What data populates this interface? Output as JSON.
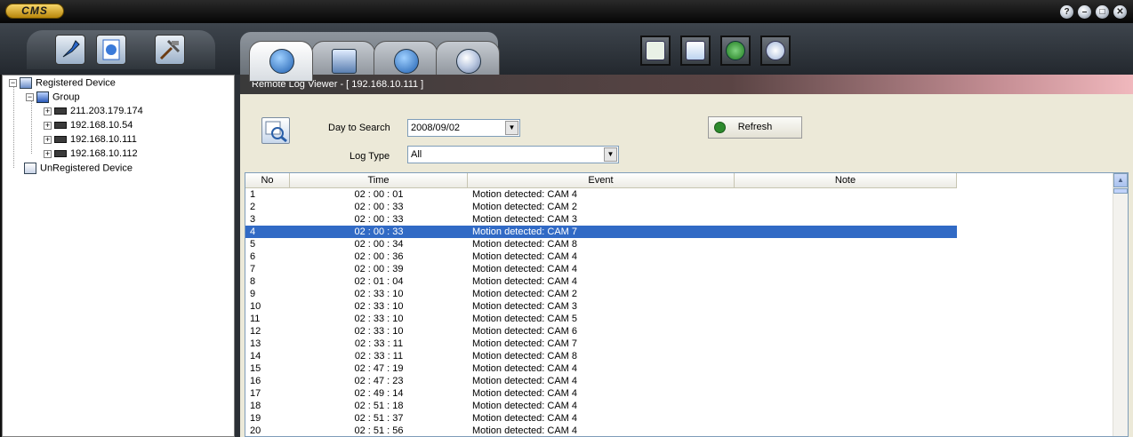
{
  "app": {
    "logo_text": "CMS"
  },
  "window_controls": [
    {
      "name": "help-button",
      "glyph": "?"
    },
    {
      "name": "minimize-button",
      "glyph": "–"
    },
    {
      "name": "maximize-button",
      "glyph": "□"
    },
    {
      "name": "close-button",
      "glyph": "✕"
    }
  ],
  "tree": {
    "registered": "Registered Device",
    "group": "Group",
    "devices": [
      "211.203.179.174",
      "192.168.10.54",
      "192.168.10.111",
      "192.168.10.112"
    ],
    "unregistered": "UnRegistered Device",
    "expand_glyph": "+",
    "collapse_glyph": "−"
  },
  "viewer": {
    "title": "Remote Log Viewer - [ 192.168.10.111 ]",
    "day_label": "Day to Search",
    "day_value": "2008/09/02",
    "logtype_label": "Log Type",
    "logtype_value": "All",
    "refresh_label": "Refresh",
    "dropdown_glyph": "▼"
  },
  "table": {
    "columns": [
      "No",
      "Time",
      "Event",
      "Note"
    ],
    "selected_row": 4,
    "rows": [
      [
        "1",
        "02 : 00 : 01",
        "Motion detected: CAM 4",
        ""
      ],
      [
        "2",
        "02 : 00 : 33",
        "Motion detected: CAM 2",
        ""
      ],
      [
        "3",
        "02 : 00 : 33",
        "Motion detected: CAM 3",
        ""
      ],
      [
        "4",
        "02 : 00 : 33",
        "Motion detected: CAM 7",
        ""
      ],
      [
        "5",
        "02 : 00 : 34",
        "Motion detected: CAM 8",
        ""
      ],
      [
        "6",
        "02 : 00 : 36",
        "Motion detected: CAM 4",
        ""
      ],
      [
        "7",
        "02 : 00 : 39",
        "Motion detected: CAM 4",
        ""
      ],
      [
        "8",
        "02 : 01 : 04",
        "Motion detected: CAM 4",
        ""
      ],
      [
        "9",
        "02 : 33 : 10",
        "Motion detected: CAM 2",
        ""
      ],
      [
        "10",
        "02 : 33 : 10",
        "Motion detected: CAM 3",
        ""
      ],
      [
        "11",
        "02 : 33 : 10",
        "Motion detected: CAM 5",
        ""
      ],
      [
        "12",
        "02 : 33 : 10",
        "Motion detected: CAM 6",
        ""
      ],
      [
        "13",
        "02 : 33 : 11",
        "Motion detected: CAM 7",
        ""
      ],
      [
        "14",
        "02 : 33 : 11",
        "Motion detected: CAM 8",
        ""
      ],
      [
        "15",
        "02 : 47 : 19",
        "Motion detected: CAM 4",
        ""
      ],
      [
        "16",
        "02 : 47 : 23",
        "Motion detected: CAM 4",
        ""
      ],
      [
        "17",
        "02 : 49 : 14",
        "Motion detected: CAM 4",
        ""
      ],
      [
        "18",
        "02 : 51 : 18",
        "Motion detected: CAM 4",
        ""
      ],
      [
        "19",
        "02 : 51 : 37",
        "Motion detected: CAM 4",
        ""
      ],
      [
        "20",
        "02 : 51 : 56",
        "Motion detected: CAM 4",
        ""
      ]
    ]
  },
  "scroll_glyph": "▲",
  "colors": {
    "selection": "#316ac5",
    "header_gradient_end": "#f0b8bd"
  }
}
